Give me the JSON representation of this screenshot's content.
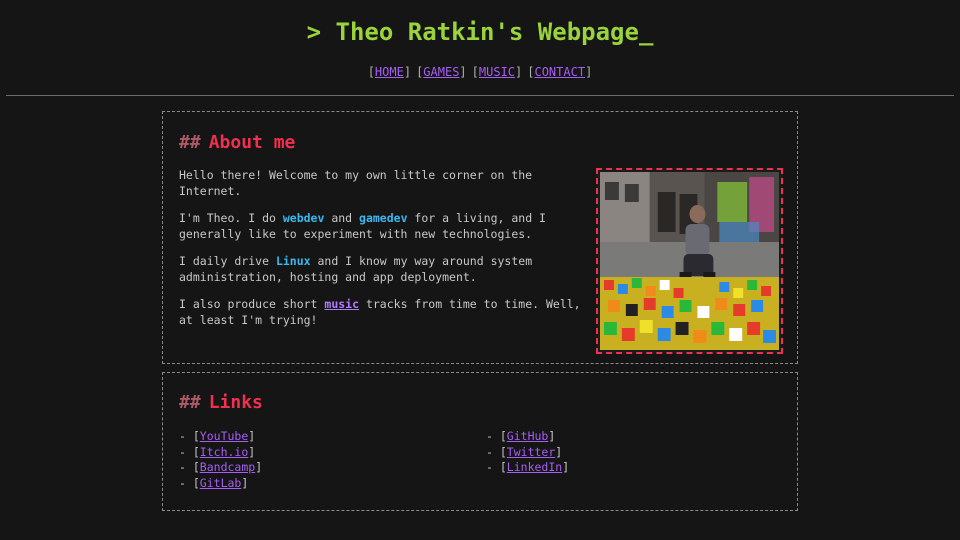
{
  "site": {
    "title": "> Theo Ratkin's Webpage_"
  },
  "nav": [
    {
      "label": "HOME"
    },
    {
      "label": "GAMES"
    },
    {
      "label": "MUSIC"
    },
    {
      "label": "CONTACT"
    }
  ],
  "about": {
    "hash": "##",
    "heading": "About me",
    "p1": "Hello there! Welcome to my own little corner on the Internet.",
    "p2_a": "I'm Theo. I do ",
    "p2_webdev": "webdev",
    "p2_b": " and ",
    "p2_gamedev": "gamedev",
    "p2_c": " for a living, and I generally like to experiment with new technologies.",
    "p3_a": "I daily drive ",
    "p3_linux": "Linux",
    "p3_b": " and I know my way around system administration, hosting and app deployment.",
    "p4_a": "I also produce short ",
    "p4_music": "music",
    "p4_b": " tracks from time to time. Well, at least I'm trying!",
    "photo_icon": "photo-of-person-with-rubiks-cubes"
  },
  "links": {
    "hash": "##",
    "heading": "Links",
    "left": [
      {
        "label": "YouTube"
      },
      {
        "label": "Itch.io"
      },
      {
        "label": "Bandcamp"
      },
      {
        "label": "GitLab"
      }
    ],
    "right": [
      {
        "label": "GitHub"
      },
      {
        "label": "Twitter"
      },
      {
        "label": "LinkedIn"
      }
    ]
  },
  "colors": {
    "background": "#151515",
    "title_green": "#9ad33c",
    "heading_red": "#f0304e",
    "link_purple": "#a65ef5",
    "highlight_blue": "#3bb8f0"
  }
}
